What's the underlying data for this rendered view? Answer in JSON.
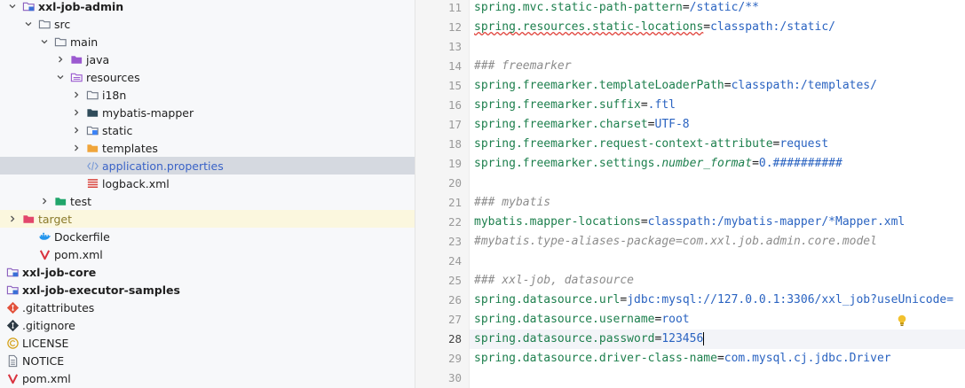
{
  "tree": [
    {
      "label": "xxl-job-admin",
      "icon": "module-folder-icon",
      "chevron": "down",
      "bold": true
    },
    {
      "label": "src",
      "icon": "folder-icon",
      "chevron": "down"
    },
    {
      "label": "main",
      "icon": "folder-icon",
      "chevron": "down"
    },
    {
      "label": "java",
      "icon": "source-folder-icon",
      "chevron": "right"
    },
    {
      "label": "resources",
      "icon": "resources-folder-icon",
      "chevron": "down"
    },
    {
      "label": "i18n",
      "icon": "folder-icon",
      "chevron": "right"
    },
    {
      "label": "mybatis-mapper",
      "icon": "dark-folder-icon",
      "chevron": "right"
    },
    {
      "label": "static",
      "icon": "web-folder-icon",
      "chevron": "right"
    },
    {
      "label": "templates",
      "icon": "templates-folder-icon",
      "chevron": "right"
    },
    {
      "label": "application.properties",
      "icon": "properties-file-icon",
      "chevron": "none",
      "selected": true
    },
    {
      "label": "logback.xml",
      "icon": "logback-file-icon",
      "chevron": "none"
    },
    {
      "label": "test",
      "icon": "test-folder-icon",
      "chevron": "right"
    },
    {
      "label": "target",
      "icon": "excluded-folder-icon",
      "chevron": "right",
      "ignored": true
    },
    {
      "label": "Dockerfile",
      "icon": "docker-file-icon",
      "chevron": "none"
    },
    {
      "label": "pom.xml",
      "icon": "maven-file-icon",
      "chevron": "none"
    },
    {
      "label": "xxl-job-core",
      "icon": "module-folder-icon",
      "chevron": "right",
      "bold": true
    },
    {
      "label": "xxl-job-executor-samples",
      "icon": "module-folder-icon",
      "chevron": "right",
      "bold": true
    },
    {
      "label": ".gitattributes",
      "icon": "git-file-icon",
      "chevron": "none"
    },
    {
      "label": ".gitignore",
      "icon": "gitignore-file-icon",
      "chevron": "none"
    },
    {
      "label": "LICENSE",
      "icon": "license-file-icon",
      "chevron": "none"
    },
    {
      "label": "NOTICE",
      "icon": "text-file-icon",
      "chevron": "none"
    },
    {
      "label": "pom.xml",
      "icon": "maven-file-icon",
      "chevron": "none"
    }
  ],
  "editor": {
    "lines": [
      {
        "no": "11",
        "parts": [
          {
            "t": "spring.mvc.static-path-pattern",
            "c": "k"
          },
          {
            "t": "=",
            "c": ""
          },
          {
            "t": "/static/**",
            "c": "v"
          }
        ]
      },
      {
        "no": "12",
        "parts": [
          {
            "t": "spring.resources.static-locations",
            "c": "k sq"
          },
          {
            "t": "=",
            "c": ""
          },
          {
            "t": "classpath:/static/",
            "c": "v"
          }
        ]
      },
      {
        "no": "13",
        "parts": []
      },
      {
        "no": "14",
        "parts": [
          {
            "t": "### freemarker",
            "c": "c"
          }
        ]
      },
      {
        "no": "15",
        "parts": [
          {
            "t": "spring.freemarker.templateLoaderPath",
            "c": "k"
          },
          {
            "t": "=",
            "c": ""
          },
          {
            "t": "classpath:/templates/",
            "c": "v"
          }
        ]
      },
      {
        "no": "16",
        "parts": [
          {
            "t": "spring.freemarker.suffix",
            "c": "k"
          },
          {
            "t": "=",
            "c": ""
          },
          {
            "t": ".ftl",
            "c": "v"
          }
        ]
      },
      {
        "no": "17",
        "parts": [
          {
            "t": "spring.freemarker.charset",
            "c": "k"
          },
          {
            "t": "=",
            "c": ""
          },
          {
            "t": "UTF-8",
            "c": "v"
          }
        ]
      },
      {
        "no": "18",
        "parts": [
          {
            "t": "spring.freemarker.request-context-attribute",
            "c": "k"
          },
          {
            "t": "=",
            "c": ""
          },
          {
            "t": "request",
            "c": "v"
          }
        ]
      },
      {
        "no": "19",
        "parts": [
          {
            "t": "spring.freemarker.settings.",
            "c": "k"
          },
          {
            "t": "number_format",
            "c": "k i"
          },
          {
            "t": "=",
            "c": ""
          },
          {
            "t": "0.##########",
            "c": "v"
          }
        ]
      },
      {
        "no": "20",
        "parts": []
      },
      {
        "no": "21",
        "parts": [
          {
            "t": "### mybatis",
            "c": "c"
          }
        ]
      },
      {
        "no": "22",
        "parts": [
          {
            "t": "mybatis.mapper-locations",
            "c": "k"
          },
          {
            "t": "=",
            "c": ""
          },
          {
            "t": "classpath:/mybatis-mapper/*Mapper.xml",
            "c": "v"
          }
        ]
      },
      {
        "no": "23",
        "parts": [
          {
            "t": "#mybatis.type-aliases-package=com.xxl.job.admin.core.model",
            "c": "c"
          }
        ]
      },
      {
        "no": "24",
        "parts": []
      },
      {
        "no": "25",
        "parts": [
          {
            "t": "### xxl-job, datasource",
            "c": "c"
          }
        ]
      },
      {
        "no": "26",
        "parts": [
          {
            "t": "spring.datasource.url",
            "c": "k"
          },
          {
            "t": "=",
            "c": ""
          },
          {
            "t": "jdbc:mysql://127.0.0.1:3306/xxl_job?useUnicode=",
            "c": "v"
          }
        ]
      },
      {
        "no": "27",
        "parts": [
          {
            "t": "spring.datasource.username",
            "c": "k"
          },
          {
            "t": "=",
            "c": ""
          },
          {
            "t": "root",
            "c": "v"
          }
        ]
      },
      {
        "no": "28",
        "parts": [
          {
            "t": "spring.datasource.password",
            "c": "k"
          },
          {
            "t": "=",
            "c": ""
          },
          {
            "t": "123456",
            "c": "v"
          }
        ],
        "current": true
      },
      {
        "no": "29",
        "parts": [
          {
            "t": "spring.datasource.driver-class-name",
            "c": "k"
          },
          {
            "t": "=",
            "c": ""
          },
          {
            "t": "com.mysql.cj.jdbc.Driver",
            "c": "v"
          }
        ]
      },
      {
        "no": "30",
        "parts": []
      }
    ]
  },
  "colors": {
    "key": "#1d7f4d",
    "value": "#2a63c1",
    "comment": "#8c8c8c",
    "selection": "#d5d9e0",
    "ignored": "#fbf7de"
  }
}
